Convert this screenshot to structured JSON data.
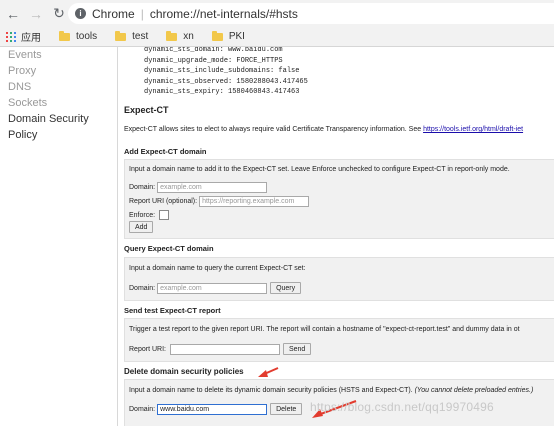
{
  "toolbar": {
    "back_icon": "arrow-left-icon",
    "forward_icon": "arrow-right-icon",
    "reload_icon": "reload-icon",
    "origin": "Chrome",
    "separator": "|",
    "url": "chrome://net-internals/#hsts"
  },
  "bookmarks": {
    "apps_label": "应用",
    "folders": [
      "tools",
      "test",
      "xn",
      "PKI"
    ]
  },
  "sidebar": {
    "items": [
      {
        "label": "Events",
        "active": false
      },
      {
        "label": "Proxy",
        "active": false
      },
      {
        "label": "DNS",
        "active": false
      },
      {
        "label": "Sockets",
        "active": false
      },
      {
        "label": "Domain Security Policy",
        "active": true
      }
    ]
  },
  "sts_result": {
    "lines": [
      "dynamic_sts_domain: www.baidu.com",
      "dynamic_upgrade_mode: FORCE_HTTPS",
      "dynamic_sts_include_subdomains: false",
      "dynamic_sts_observed: 1580288043.417465",
      "dynamic_sts_expiry: 1580460843.417463"
    ]
  },
  "expect_ct": {
    "title": "Expect-CT",
    "desc_prefix": "Expect-CT allows sites to elect to always require valid Certificate Transparency information. See ",
    "desc_link": "https://tools.ietf.org/html/draft-iet"
  },
  "add_ct": {
    "title": "Add Expect-CT domain",
    "desc": "Input a domain name to add it to the Expect-CT set. Leave Enforce unchecked to configure Expect-CT in report-only mode.",
    "domain_label": "Domain:",
    "domain_placeholder": "example.com",
    "report_label": "Report URI (optional):",
    "report_placeholder": "https://reporting.example.com",
    "enforce_label": "Enforce:",
    "add_button": "Add"
  },
  "query_ct": {
    "title": "Query Expect-CT domain",
    "desc": "Input a domain name to query the current Expect-CT set:",
    "domain_label": "Domain:",
    "domain_placeholder": "example.com",
    "query_button": "Query"
  },
  "send_ct": {
    "title": "Send test Expect-CT report",
    "desc": "Trigger a test report to the given report URI. The report will contain a hostname of \"expect-ct-report.test\" and dummy data in ot",
    "report_label": "Report URI:",
    "send_button": "Send"
  },
  "delete_policy": {
    "title": "Delete domain security policies",
    "desc": "Input a domain name to delete its dynamic domain security policies (HSTS and Expect-CT).",
    "desc_italic": "(You cannot delete preloaded entries.)",
    "domain_label": "Domain:",
    "domain_value": "www.baidu.com",
    "delete_button": "Delete"
  },
  "watermark": "https://blog.csdn.net/qq19970496",
  "colors": {
    "annotation_red": "#e23b2e",
    "link_blue": "#1a0dab",
    "focus_blue": "#2f6fd1"
  }
}
